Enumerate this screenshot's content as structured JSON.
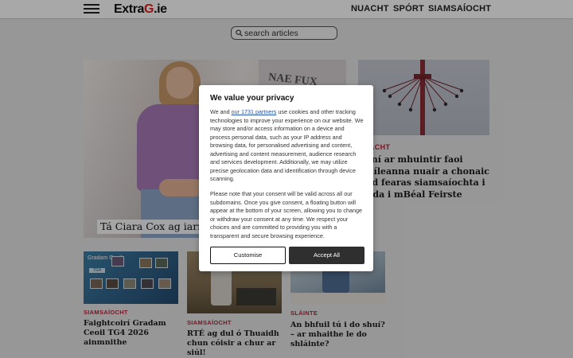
{
  "header": {
    "logo": {
      "part1": "Extra",
      "part2": "G",
      "part3": ".ie"
    },
    "nav": [
      "NUACHT",
      "SPÓRT",
      "SIAMSAÍOCHT"
    ]
  },
  "search": {
    "placeholder": "search articles"
  },
  "hero": {
    "caption": "Tá Ciara Cox ag iarraidh",
    "shirt_text": "NAE FUX"
  },
  "side_story": {
    "category": "NUACHT",
    "title": "Imní ar mhuintir faoi mhíleanna nuair a chonaic siad fearas siamsaíochta i stada i mBéal Feirste"
  },
  "cards": [
    {
      "category": "SIAMSAÍOCHT",
      "title": "Faightcoirí Gradam Ceoil TG4 2026 ainmnithe",
      "image_text": "Gradam Ceoil",
      "image_badge": "TG4"
    },
    {
      "category": "SIAMSAÍOCHT",
      "title": "RTÉ ag dul ó Thuaidh chun cóisir a chur ar siúl!"
    },
    {
      "category": "SLÁINTE",
      "title": "An bhfuil tú i do shuí? – ar mhaithe le do shláinte?"
    }
  ],
  "consent": {
    "title": "We value your privacy",
    "p1_before": "We and ",
    "p1_link": "our 1731 partners",
    "p1_after": " use cookies and other tracking technologies to improve your experience on our website. We may store and/or access information on a device and process personal data, such as your IP address and browsing data, for personalised advertising and content, advertising and content measurement, audience research and services development. Additionally, we may utilize precise geolocation data and identification through device scanning.",
    "p2": "Please note that your consent will be valid across all our subdomains. Once you give consent, a floating button will appear at the bottom of your screen, allowing you to change or withdraw your consent at any time. We respect your choices and are committed to providing you with a transparent and secure browsing experience.",
    "customise_label": "Customise",
    "accept_label": "Accept All"
  },
  "colors": {
    "accent": "#e0201c",
    "category": "#b6243a",
    "accept_button": "#2f2f2f"
  }
}
